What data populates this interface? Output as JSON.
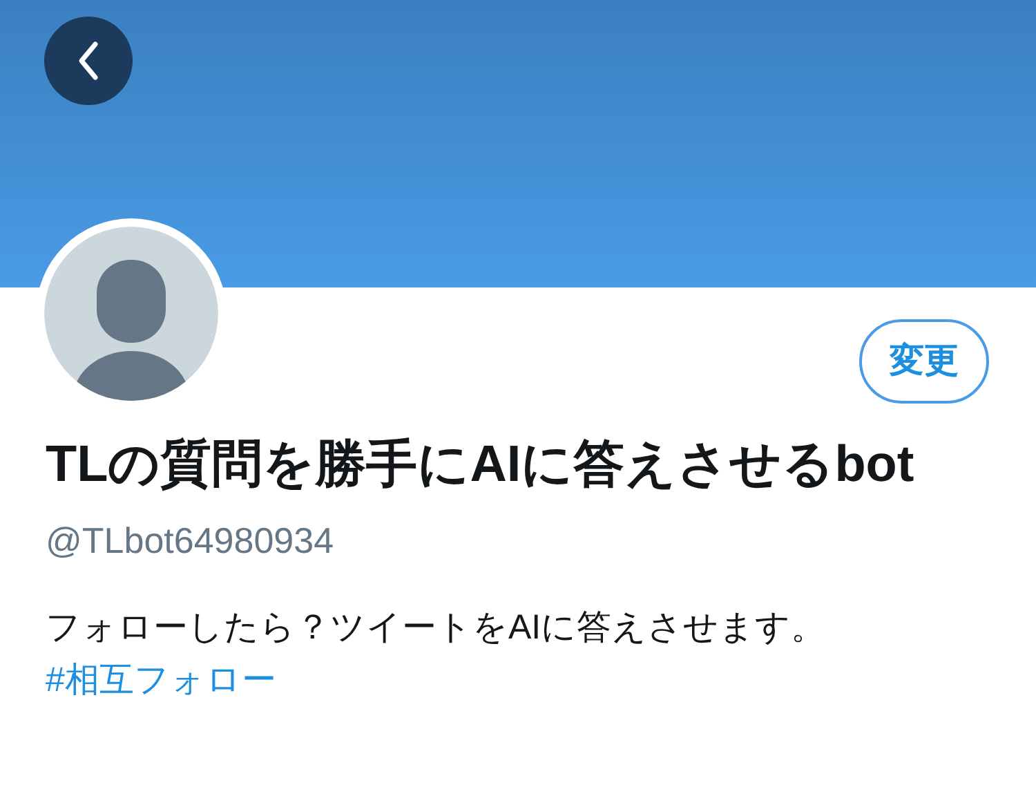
{
  "edit_button": {
    "label": "変更"
  },
  "profile": {
    "name": "TLの質問を勝手にAIに答えさせるbot",
    "handle": "@TLbot64980934"
  },
  "bio": {
    "text": "フォローしたら？ツイートをAIに答えさせます。",
    "hashtag": "#相互フォロー"
  }
}
